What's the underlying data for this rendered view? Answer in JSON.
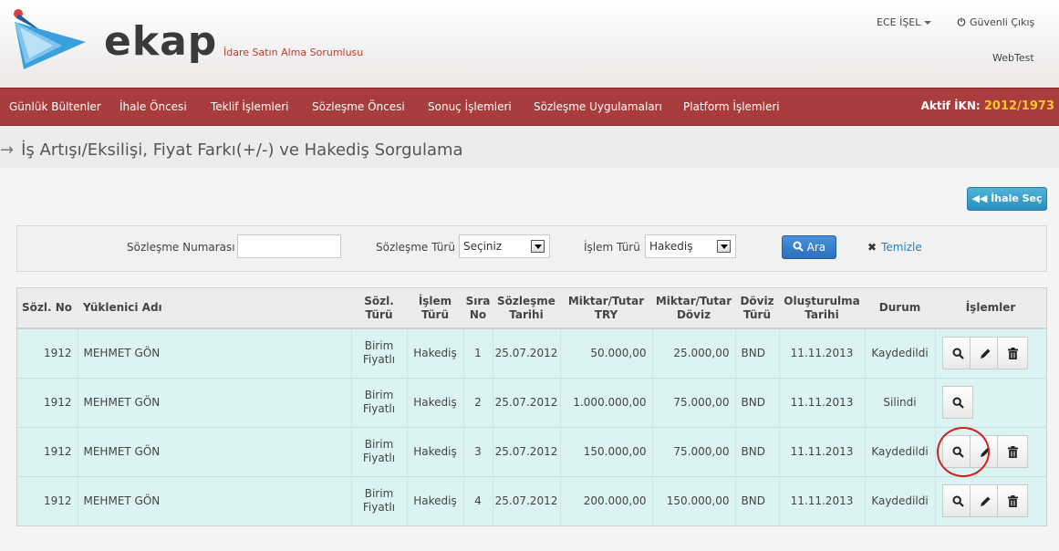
{
  "brand": {
    "name": "ekap",
    "subtitle": "İdare Satın Alma Sorumlusu"
  },
  "user": {
    "name": "ECE İŞEL",
    "logout": "Güvenli Çıkış",
    "env": "WebTest"
  },
  "nav": {
    "items": [
      "Günlük Bültenler",
      "İhale Öncesi",
      "Teklif İşlemleri",
      "Sözleşme Öncesi",
      "Sonuç İşlemleri",
      "Sözleşme Uygulamaları",
      "Platform İşlemleri"
    ],
    "ikn_label": "Aktif İKN:",
    "ikn_value": "2012/1973"
  },
  "page": {
    "title": "İş Artışı/Eksilişi, Fiyat Farkı(+/-) ve Hakediş Sorgulama"
  },
  "toolbar": {
    "ihale_sec": "İhale Seç"
  },
  "search": {
    "contract_no_label": "Sözleşme Numarası",
    "contract_no_value": "",
    "contract_type_label": "Sözleşme Türü",
    "contract_type_value": "Seçiniz",
    "operation_type_label": "İşlem Türü",
    "operation_type_value": "Hakediş",
    "search_button": "Ara",
    "clear_link": "Temizle"
  },
  "table": {
    "headers": {
      "contract_no": "Sözl. No",
      "contractor": "Yüklenici Adı",
      "contract_type": [
        "Sözl.",
        "Türü"
      ],
      "operation_type": [
        "İşlem",
        "Türü"
      ],
      "seq_no": [
        "Sıra",
        "No"
      ],
      "contract_date": [
        "Sözleşme",
        "Tarihi"
      ],
      "amount_try": [
        "Miktar/Tutar",
        "TRY"
      ],
      "amount_fx": [
        "Miktar/Tutar",
        "Döviz"
      ],
      "currency": [
        "Döviz",
        "Türü"
      ],
      "created": [
        "Oluşturulma",
        "Tarihi"
      ],
      "status": "Durum",
      "actions": "İşlemler"
    },
    "rows": [
      {
        "contract_no": "1912",
        "contractor": "MEHMET GÖN",
        "contract_type": [
          "Birim",
          "Fiyatlı"
        ],
        "operation_type": "Hakediş",
        "seq_no": "1",
        "contract_date": "25.07.2012",
        "amount_try": "50.000,00",
        "amount_fx": "25.000,00",
        "currency": "BND",
        "created": "11.11.2013",
        "status": "Kaydedildi",
        "actions": [
          "view",
          "edit",
          "delete"
        ]
      },
      {
        "contract_no": "1912",
        "contractor": "MEHMET GÖN",
        "contract_type": [
          "Birim",
          "Fiyatlı"
        ],
        "operation_type": "Hakediş",
        "seq_no": "2",
        "contract_date": "25.07.2012",
        "amount_try": "1.000.000,00",
        "amount_fx": "75.000,00",
        "currency": "BND",
        "created": "11.11.2013",
        "status": "Silindi",
        "actions": [
          "view"
        ]
      },
      {
        "contract_no": "1912",
        "contractor": "MEHMET GÖN",
        "contract_type": [
          "Birim",
          "Fiyatlı"
        ],
        "operation_type": "Hakediş",
        "seq_no": "3",
        "contract_date": "25.07.2012",
        "amount_try": "150.000,00",
        "amount_fx": "75.000,00",
        "currency": "BND",
        "created": "11.11.2013",
        "status": "Kaydedildi",
        "actions": [
          "view",
          "edit",
          "delete"
        ]
      },
      {
        "contract_no": "1912",
        "contractor": "MEHMET GÖN",
        "contract_type": [
          "Birim",
          "Fiyatlı"
        ],
        "operation_type": "Hakediş",
        "seq_no": "4",
        "contract_date": "25.07.2012",
        "amount_try": "200.000,00",
        "amount_fx": "150.000,00",
        "currency": "BND",
        "created": "11.11.2013",
        "status": "Kaydedildi",
        "actions": [
          "view",
          "edit",
          "delete"
        ]
      }
    ]
  },
  "colors": {
    "nav": "#a93c3c",
    "ikn": "#f7c820",
    "row": "#dcf3f3",
    "accent": "#2c6fbf",
    "brand_red": "#c0392b"
  },
  "icons": {
    "view": "search-icon",
    "edit": "pencil-icon",
    "delete": "trash-icon",
    "logout": "power-icon",
    "back": "double-arrow-left-icon",
    "clear": "x-icon"
  }
}
